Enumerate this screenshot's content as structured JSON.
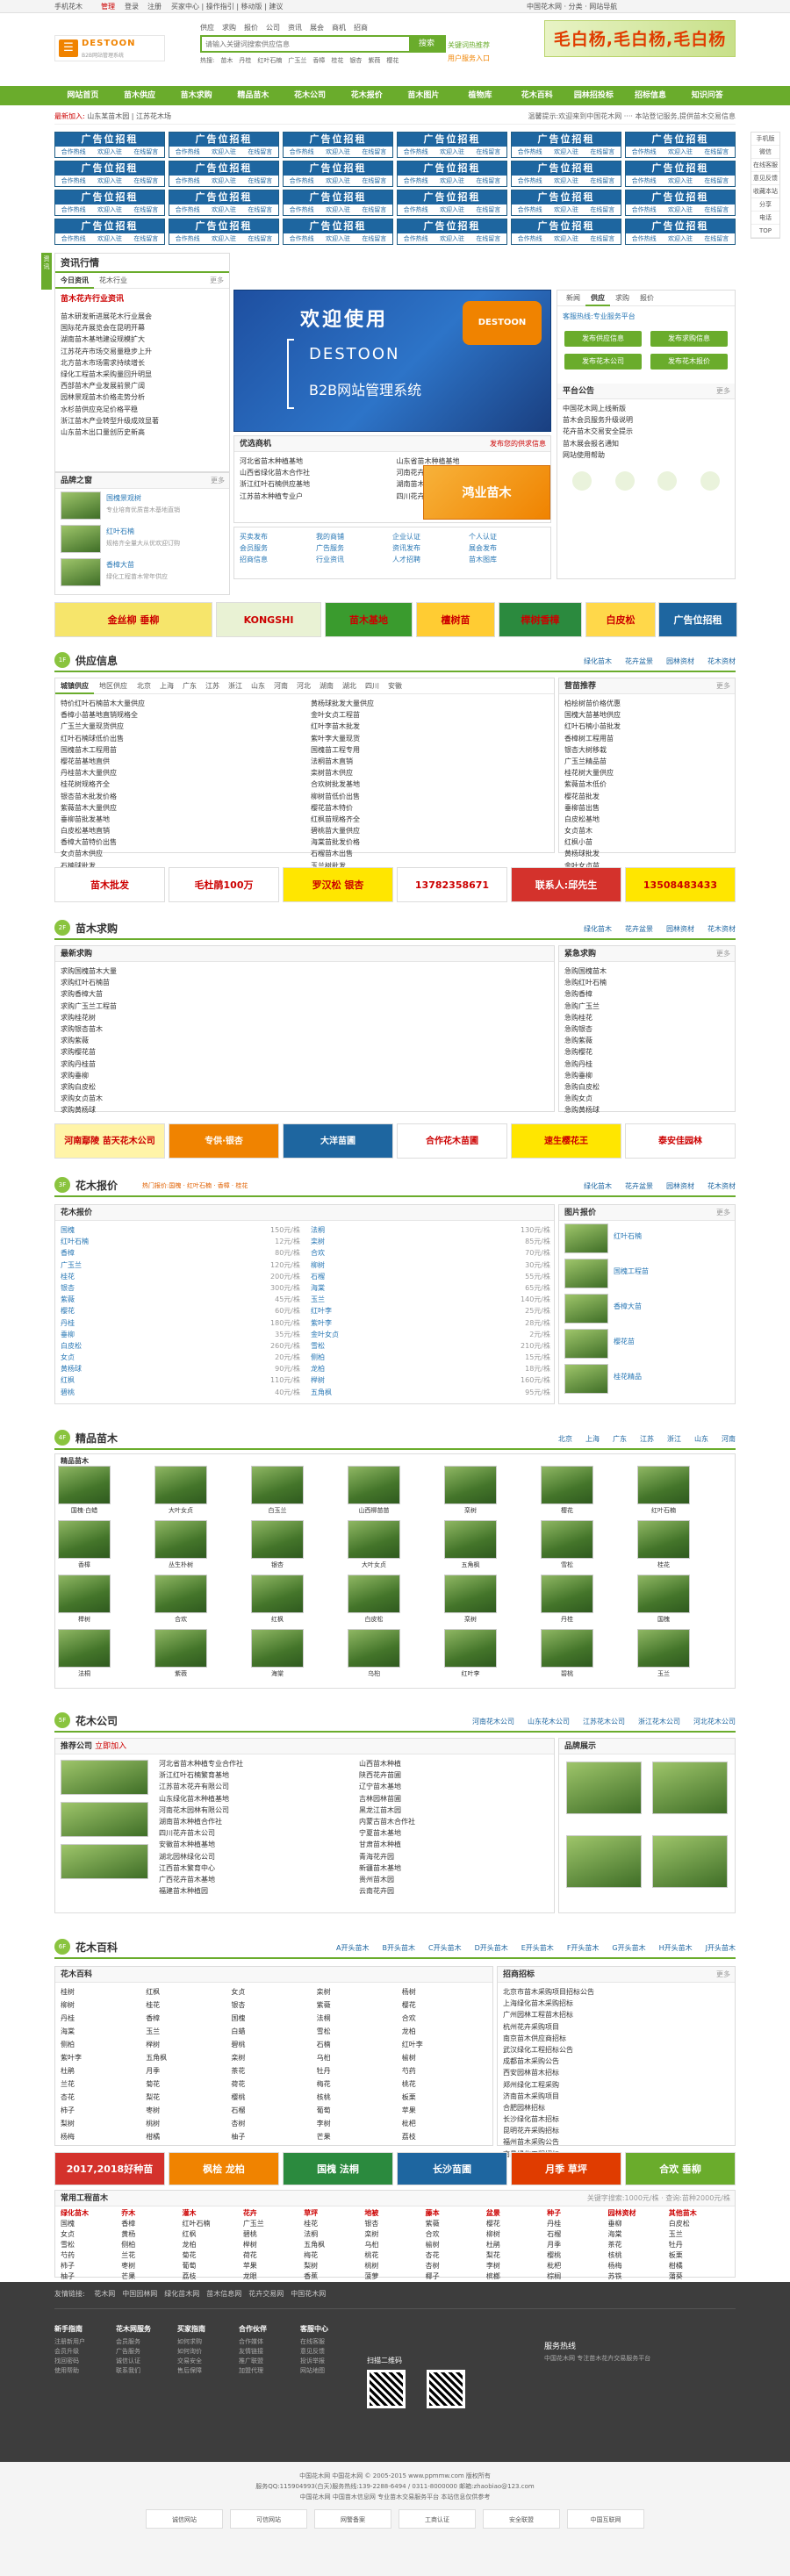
{
  "topbar": {
    "mobile": "手机花木",
    "manage": "管理",
    "login": "登录",
    "register": "注册",
    "left_links": "买家中心 | 操作指引 | 移动版 | 建议",
    "right": "中国花木网 · 分类 · 网站导航"
  },
  "logo": {
    "brand": "DESTOON",
    "tagline": "B2B网站管理系统"
  },
  "search": {
    "tabs": [
      "供应",
      "求购",
      "报价",
      "公司",
      "资讯",
      "展会",
      "商机",
      "招商"
    ],
    "placeholder": "请输入关键词搜索供应信息",
    "button": "搜索",
    "hot": [
      "热搜:",
      "苗木",
      "丹桂",
      "红叶石楠",
      "广玉兰",
      "香樟",
      "桂花",
      "银杏",
      "紫薇",
      "樱花"
    ],
    "note1": "关键词热推荐",
    "note2": "用户服务入口"
  },
  "header_banner": "毛白杨,毛白杨,毛白杨",
  "nav": [
    "网站首页",
    "苗木供应",
    "苗木求购",
    "精品苗木",
    "花木公司",
    "花木报价",
    "苗木图片",
    "植物库",
    "花木百科",
    "园林招投标",
    "招标信息",
    "知识问答"
  ],
  "subbar": {
    "left": "最新加入:",
    "left_text": "山东某苗木园 | 江苏花木场",
    "right": "温馨提示:欢迎来到中国花木网 ···· 本站登记服务,提供苗木交易信息"
  },
  "ads": {
    "cell_title": "广告位招租",
    "cell_sub": [
      "合作热线",
      "欢迎入驻",
      "在线留言"
    ]
  },
  "side_float": [
    "手机版",
    "微信",
    "在线客服",
    "意见反馈",
    "收藏本站",
    "分享",
    "电话",
    "TOP"
  ],
  "news": {
    "title": "资讯行情",
    "tabs": [
      "今日资讯",
      "苗木行情",
      "花卉行情",
      "园林资讯",
      "行业动态",
      "政策法规"
    ],
    "sub_tab": "花木行业",
    "more": "更多",
    "headline": "苗木花卉行业资讯",
    "items": [
      "苗木研发新进展花木行业展会",
      "国际花卉展览会在昆明开幕",
      "湖南苗木基地建设规模扩大",
      "江苏花卉市场交易量稳步上升",
      "北方苗木市场需求持续增长",
      "绿化工程苗木采购量回升明显",
      "西部苗木产业发展前景广阔",
      "园林景观苗木价格走势分析"
    ],
    "extra": [
      "水杉苗供应充足价格平稳",
      "浙江苗木产业转型升级成效显著",
      "山东苗木出口量创历史新高"
    ]
  },
  "products": {
    "title": "品牌之窗",
    "items": [
      {
        "name": "国槐景观树",
        "desc": "专业培育优质苗木基地直销"
      },
      {
        "name": "红叶石楠",
        "desc": "规格齐全量大从优欢迎订购"
      },
      {
        "name": "香樟大苗",
        "desc": "绿化工程苗木常年供应"
      }
    ]
  },
  "slider": {
    "welcome": "欢迎使用",
    "brand": "DESTOON",
    "subtitle": "B2B网站管理系统"
  },
  "opportunity": {
    "title": "优选商机",
    "note": "发布您的供求信息",
    "items": [
      "河北省苗木种植基地",
      "山西省绿化苗木合作社",
      "浙江红叶石楠供应基地",
      "江苏苗木种植专业户",
      "山东省苗木种植基地",
      "河南花卉苗木繁育中心",
      "湖南苗木合作社",
      "四川花卉苗木种植园"
    ]
  },
  "quick": {
    "items": [
      "买卖发布",
      "我的商铺",
      "企业认证",
      "个人认证",
      "会员服务",
      "广告服务",
      "资讯发布",
      "展会发布",
      "招商信息",
      "行业资讯",
      "人才招聘",
      "苗木图库"
    ]
  },
  "member": {
    "tabs": [
      "新闻",
      "供应",
      "求购",
      "报价"
    ],
    "notice": "客服热线:专业服务平台",
    "buttons": [
      "发布供应信息",
      "发布求购信息",
      "发布花木公司",
      "发布花木报价"
    ],
    "notice_title": "平台公告",
    "notice_items": [
      "中国花木网上线新版",
      "苗木会员服务升级说明",
      "花卉苗木交易安全提示",
      "苗木展会报名通知",
      "网站使用帮助"
    ]
  },
  "midbanner": {
    "items": [
      "金丝柳 垂柳",
      "KONGSHI",
      "苗木基地",
      "檀树苗",
      "榉树香樟",
      "白皮松",
      "广告位招租"
    ]
  },
  "supply": {
    "title": "供应信息",
    "tags": [
      "绿化苗木",
      "花卉盆景",
      "园林资材",
      "花木资材"
    ],
    "tabs": [
      "城镇供应",
      "地区供应"
    ],
    "filters": [
      "北京",
      "上海",
      "广东",
      "江苏",
      "浙江",
      "山东",
      "河南",
      "河北",
      "湖南",
      "湖北",
      "四川",
      "安徽"
    ],
    "left": [
      "特价红叶石楠苗木大量供应",
      "香樟小苗基地直销规格全",
      "广玉兰大量现货供应",
      "红叶石楠球低价出售",
      "国槐苗木工程用苗",
      "樱花苗基地直供",
      "丹桂苗木大量供应",
      "桂花树规格齐全",
      "银杏苗木批发价格",
      "紫薇苗木大量供应",
      "垂柳苗批发基地",
      "白皮松基地直销",
      "香樟大苗特价出售",
      "女贞苗木供应",
      "石楠球批发"
    ],
    "right": [
      "黄杨球批发大量供应",
      "金叶女贞工程苗",
      "红叶李苗木批发",
      "紫叶李大量现货",
      "国槐苗工程专用",
      "法桐苗木直销",
      "栾树苗木供应",
      "合欢树批发基地",
      "柳树苗低价出售",
      "樱花苗木特价",
      "红枫苗规格齐全",
      "碧桃苗大量供应",
      "海棠苗批发价格",
      "石榴苗木出售",
      "玉兰树批发"
    ],
    "right_title": "营苗推荐",
    "right_items": [
      "柏桧树苗价格优惠",
      "国槐大苗基地供应",
      "红叶石楠小苗批发",
      "香樟树工程用苗",
      "银杏大树移栽",
      "广玉兰精品苗",
      "桂花树大量供应",
      "紫薇苗木低价",
      "樱花苗批发",
      "垂柳苗出售",
      "白皮松基地",
      "女贞苗木",
      "红枫小苗",
      "黄杨球批发",
      "金叶女贞苗"
    ]
  },
  "strip2": [
    "苗木批发",
    "毛杜鹃100万",
    "罗汉松 银杏",
    "13782358671",
    "联系人:邱先生",
    "13508483433"
  ],
  "buying": {
    "title": "苗木求购",
    "tags": [
      "绿化苗木",
      "花卉盆景",
      "园林资材",
      "花木资材"
    ],
    "left_title": "最新求购",
    "right_title": "紧急求购",
    "left": [
      "求购国槐苗木大量",
      "求购红叶石楠苗",
      "求购香樟大苗",
      "求购广玉兰工程苗",
      "求购桂花树",
      "求购银杏苗木",
      "求购紫薇",
      "求购樱花苗",
      "求购丹桂苗",
      "求购垂柳",
      "求购白皮松",
      "求购女贞苗木",
      "求购黄杨球"
    ],
    "right": [
      "急购国槐苗木",
      "急购红叶石楠",
      "急购香樟",
      "急购广玉兰",
      "急购桂花",
      "急购银杏",
      "急购紫薇",
      "急购樱花",
      "急购丹桂",
      "急购垂柳",
      "急购白皮松",
      "急购女贞",
      "急购黄杨球"
    ]
  },
  "strip3": [
    "河南鄢陵 苗天花木公司",
    "专供·银杏",
    "大洋苗圃",
    "合作花木苗圃",
    "速生樱花王",
    "泰安佳园林"
  ],
  "price": {
    "title": "花木报价",
    "slogan": "热门报价:国槐 · 红叶石楠 · 香樟 · 桂花",
    "tags": [
      "绿化苗木",
      "花卉盆景",
      "园林资材",
      "花木资材"
    ],
    "left_title": "花木报价",
    "right_title": "图片报价",
    "left": [
      [
        "国槐",
        "150元/株"
      ],
      [
        "红叶石楠",
        "12元/株"
      ],
      [
        "香樟",
        "80元/株"
      ],
      [
        "广玉兰",
        "120元/株"
      ],
      [
        "桂花",
        "200元/株"
      ],
      [
        "银杏",
        "300元/株"
      ],
      [
        "紫薇",
        "45元/株"
      ],
      [
        "樱花",
        "60元/株"
      ],
      [
        "丹桂",
        "180元/株"
      ],
      [
        "垂柳",
        "35元/株"
      ],
      [
        "白皮松",
        "260元/株"
      ],
      [
        "女贞",
        "20元/株"
      ],
      [
        "黄杨球",
        "90元/株"
      ],
      [
        "红枫",
        "110元/株"
      ],
      [
        "碧桃",
        "40元/株"
      ]
    ],
    "right": [
      [
        "法桐",
        "130元/株"
      ],
      [
        "栾树",
        "85元/株"
      ],
      [
        "合欢",
        "70元/株"
      ],
      [
        "柳树",
        "30元/株"
      ],
      [
        "石榴",
        "55元/株"
      ],
      [
        "海棠",
        "65元/株"
      ],
      [
        "玉兰",
        "140元/株"
      ],
      [
        "红叶李",
        "25元/株"
      ],
      [
        "紫叶李",
        "28元/株"
      ],
      [
        "金叶女贞",
        "2元/株"
      ],
      [
        "雪松",
        "210元/株"
      ],
      [
        "侧柏",
        "15元/株"
      ],
      [
        "龙柏",
        "18元/株"
      ],
      [
        "榉树",
        "160元/株"
      ],
      [
        "五角枫",
        "95元/株"
      ]
    ],
    "pic": [
      "红叶石楠",
      "国槐工程苗",
      "香樟大苗",
      "樱花苗",
      "桂花精品"
    ]
  },
  "fine": {
    "title": "精品苗木",
    "tags": [
      "北京",
      "上海",
      "广东",
      "江苏",
      "浙江",
      "山东",
      "河南"
    ],
    "sub": "精品苗木",
    "items": [
      "国槐·白蜡",
      "大叶女贞",
      "白玉兰",
      "山西柳苗苗",
      "栾树",
      "樱花",
      "红叶石楠",
      "香樟",
      "丛生朴树",
      "银杏",
      "大叶女贞",
      "五角枫",
      "雪松",
      "桂花",
      "榉树",
      "合欢",
      "红枫",
      "白皮松",
      "栾树",
      "丹桂",
      "国槐",
      "法桐",
      "紫薇",
      "海棠",
      "乌桕",
      "红叶李",
      "碧桃",
      "玉兰"
    ]
  },
  "company": {
    "title": "花木公司",
    "tags": [
      "河南花木公司",
      "山东花木公司",
      "江苏花木公司",
      "浙江花木公司",
      "河北花木公司"
    ],
    "left_title": "推荐公司",
    "join": "立即加入",
    "brand_title": "品牌展示",
    "items": [
      "河北省苗木种植专业合作社",
      "浙江红叶石楠繁育基地",
      "江苏苗木花卉有限公司",
      "山东绿化苗木种植基地",
      "河南花木园林有限公司",
      "湖南苗木种植合作社",
      "四川花卉苗木公司",
      "安徽苗木种植基地",
      "湖北园林绿化公司",
      "江西苗木繁育中心",
      "广西花卉苗木基地",
      "福建苗木种植园"
    ],
    "mid": [
      "山西苗木种植",
      "陕西花卉苗圃",
      "辽宁苗木基地",
      "吉林园林苗圃",
      "黑龙江苗木园",
      "内蒙古苗木合作社",
      "宁夏苗木基地",
      "甘肃苗木种植",
      "青海花卉园",
      "新疆苗木基地",
      "贵州苗木园",
      "云南花卉园"
    ]
  },
  "baike": {
    "title": "花木百科",
    "tags": [
      "A开头苗木",
      "B开头苗木",
      "C开头苗木",
      "D开头苗木",
      "E开头苗木",
      "F开头苗木",
      "G开头苗木",
      "H开头苗木",
      "J开头苗木"
    ],
    "left_title": "花木百科",
    "right_title": "招商招标",
    "grid": [
      "桂树",
      "红枫",
      "女贞",
      "栾树",
      "杨树",
      "柳树",
      "桂花",
      "银杏",
      "紫薇",
      "樱花",
      "丹桂",
      "香樟",
      "国槐",
      "法桐",
      "合欢",
      "海棠",
      "玉兰",
      "白蜡",
      "雪松",
      "龙柏",
      "侧柏",
      "榉树",
      "碧桃",
      "石楠",
      "红叶李",
      "紫叶李",
      "五角枫",
      "栾树",
      "乌桕",
      "榆树",
      "杜鹃",
      "月季",
      "茶花",
      "牡丹",
      "芍药",
      "兰花",
      "菊花",
      "荷花",
      "梅花",
      "桃花",
      "杏花",
      "梨花",
      "樱桃",
      "核桃",
      "板栗",
      "柿子",
      "枣树",
      "石榴",
      "葡萄",
      "苹果",
      "梨树",
      "桃树",
      "杏树",
      "李树",
      "枇杷",
      "杨梅",
      "柑橘",
      "柚子",
      "芒果",
      "荔枝"
    ],
    "tender": [
      "北京市苗木采购项目招标公告",
      "上海绿化苗木采购招标",
      "广州园林工程苗木招标",
      "杭州花卉采购项目",
      "南京苗木供应商招标",
      "武汉绿化工程招标公告",
      "成都苗木采购公告",
      "西安园林苗木招标",
      "郑州绿化工程采购",
      "济南苗木采购项目",
      "合肥园林招标",
      "长沙绿化苗木招标",
      "昆明花卉采购招标",
      "福州苗木采购公告",
      "南昌绿化工程招标"
    ]
  },
  "strip4": [
    "2017,2018好种苗",
    "枫桧 龙柏",
    "国槐 法桐",
    "长沙苗圃",
    "月季 草坪",
    "合欢 垂柳"
  ],
  "tools": {
    "title": "常用工程苗木",
    "right": "关键字搜索:1000元/株 · 查询:苗种2000元/株",
    "cols": [
      "绿化苗木",
      "乔木",
      "灌木",
      "花卉",
      "草坪",
      "地被",
      "藤本",
      "盆景",
      "种子",
      "园林资材",
      "其他苗木"
    ],
    "rows": [
      [
        "国槐",
        "香樟",
        "红叶石楠",
        "广玉兰",
        "桂花",
        "银杏",
        "紫薇",
        "樱花",
        "丹桂",
        "垂柳",
        "白皮松"
      ],
      [
        "女贞",
        "黄杨",
        "红枫",
        "碧桃",
        "法桐",
        "栾树",
        "合欢",
        "柳树",
        "石榴",
        "海棠",
        "玉兰"
      ],
      [
        "雪松",
        "侧柏",
        "龙柏",
        "榉树",
        "五角枫",
        "乌桕",
        "榆树",
        "杜鹃",
        "月季",
        "茶花",
        "牡丹"
      ],
      [
        "芍药",
        "兰花",
        "菊花",
        "荷花",
        "梅花",
        "桃花",
        "杏花",
        "梨花",
        "樱桃",
        "核桃",
        "板栗"
      ],
      [
        "柿子",
        "枣树",
        "葡萄",
        "苹果",
        "梨树",
        "桃树",
        "杏树",
        "李树",
        "枇杷",
        "杨梅",
        "柑橘"
      ],
      [
        "柚子",
        "芒果",
        "荔枝",
        "龙眼",
        "香蕉",
        "菠萝",
        "椰子",
        "槟榔",
        "棕榈",
        "苏铁",
        "蒲葵"
      ]
    ]
  },
  "links": {
    "label": "友情链接:",
    "items": [
      "花木网",
      "中国园林网",
      "绿化苗木网",
      "苗木信息网",
      "花卉交易网",
      "中国花木网"
    ]
  },
  "footer": {
    "cols": [
      {
        "title": "新手指南",
        "items": [
          "注册新用户",
          "会员升级",
          "找回密码",
          "使用帮助"
        ]
      },
      {
        "title": "花木网服务",
        "items": [
          "会员服务",
          "广告服务",
          "诚信认证",
          "联系我们"
        ]
      },
      {
        "title": "买家指南",
        "items": [
          "如何求购",
          "如何询价",
          "交易安全",
          "售后保障"
        ]
      },
      {
        "title": "合作伙伴",
        "items": [
          "合作媒体",
          "友情链接",
          "推广联盟",
          "加盟代理"
        ]
      },
      {
        "title": "客服中心",
        "items": [
          "在线客服",
          "意见反馈",
          "投诉举报",
          "网站地图"
        ]
      }
    ],
    "qr_label": "扫描二维码",
    "right": "服务热线",
    "right_text": "中国花木网 专注苗木花卉交易服务平台"
  },
  "bottom": {
    "lines": [
      "中国花木网 中国花木网 © 2005-2015 www.ppmmw.com 版权所有",
      "服务QQ:115904993(白天)服务热线:139-2288-6494 / 0311-8000000 邮箱:zhaobiao@123.com",
      "中国花木网 中国苗木信息网 专业苗木交易服务平台 本站信息仅供参考"
    ],
    "seals": [
      "诚信网站",
      "可信网站",
      "网警备案",
      "工商认证",
      "安全联盟",
      "中国互联网"
    ]
  }
}
